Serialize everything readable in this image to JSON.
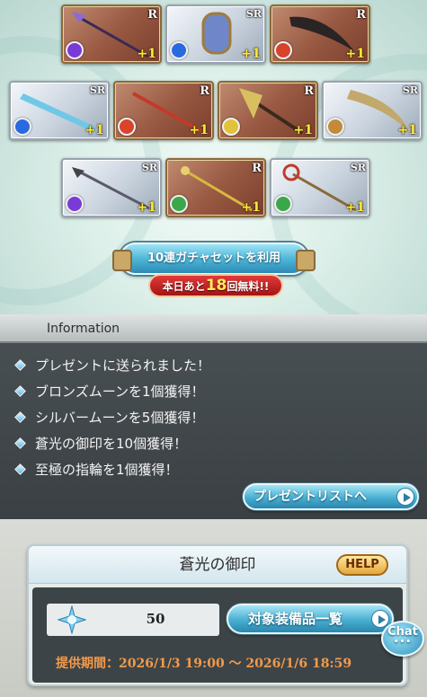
{
  "gacha": {
    "cards": [
      {
        "rarity": "R",
        "plus": "+1",
        "element": "#7a3ad6"
      },
      {
        "rarity": "SR",
        "plus": "+1",
        "element": "#2a6ae0"
      },
      {
        "rarity": "R",
        "plus": "+1",
        "element": "#d8432a"
      },
      {
        "rarity": "SR",
        "plus": "+1",
        "element": "#2a6ae0"
      },
      {
        "rarity": "R",
        "plus": "+1",
        "element": "#d8432a"
      },
      {
        "rarity": "R",
        "plus": "+1",
        "element": "#e2c23a"
      },
      {
        "rarity": "SR",
        "plus": "+1",
        "element": "#c28a3a"
      },
      {
        "rarity": "SR",
        "plus": "+1",
        "element": "#7a3ad6"
      },
      {
        "rarity": "R",
        "plus": "+1",
        "element": "#3aa84a"
      },
      {
        "rarity": "SR",
        "plus": "+1",
        "element": "#3aa84a"
      }
    ],
    "button_label": "10連ガチャセットを利用",
    "free_prefix": "本日あと",
    "free_count": "18",
    "free_suffix": "回無料!!"
  },
  "information": {
    "title": "Information",
    "items": [
      "プレゼントに送られました！",
      "ブロンズムーンを1個獲得！",
      "シルバームーンを5個獲得！",
      "蒼光の御印を10個獲得！",
      "至極の指輪を1個獲得！"
    ],
    "present_button": "プレゼントリストへ"
  },
  "item": {
    "name": "蒼光の御印",
    "help": "HELP",
    "count": "50",
    "equip_button": "対象装備品一覧",
    "period": "提供期間：2026/1/3 19:00 〜 2026/1/6 18:59"
  },
  "chat": {
    "label": "Chat"
  }
}
